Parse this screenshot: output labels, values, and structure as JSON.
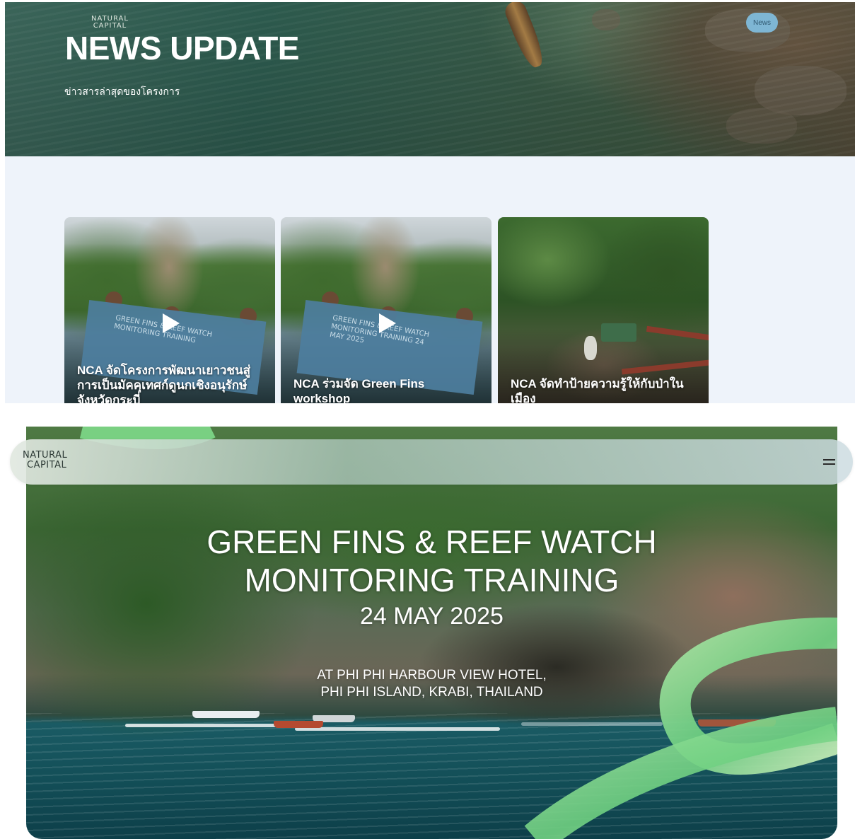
{
  "top_panel": {
    "logo": {
      "line1": "NATURAL",
      "line2": "CAPITAL"
    },
    "title": "NEWS UPDATE",
    "subtitle": "ข่าวสารล่าสุดของโครงการ",
    "badge": "News",
    "cards": [
      {
        "title": "NCA จัดโครงการพัฒนาเยาวชนสู่การเป็นมัคคุเทศก์ดูนกเชิงอนุรักษ์ จังหวัดกระบี่",
        "has_video": true,
        "banner_text": "GREEN FINS & REEF WATCH MONITORING TRAINING"
      },
      {
        "title": "NCA ร่วมจัด Green Fins workshop",
        "has_video": true,
        "banner_text": "GREEN FINS & REEF WATCH MONITORING TRAINING 24 MAY 2025"
      },
      {
        "title": "NCA จัดทำป้ายความรู้ให้กับป่าในเมือง",
        "has_video": false,
        "banner_text": ""
      }
    ]
  },
  "bottom_panel": {
    "logo": {
      "line1": "NATURAL",
      "line2": "CAPITAL"
    },
    "menu_icon": "hamburger-menu-icon",
    "video_title_line1": "GREEN FINS & REEF WATCH",
    "video_title_line2": "MONITORING TRAINING",
    "video_date": "24 MAY 2025",
    "video_location_line1": "AT PHI PHI HARBOUR VIEW HOTEL,",
    "video_location_line2": "PHI PHI ISLAND, KRABI, THAILAND"
  },
  "colors": {
    "accent_green": "#7ed98a",
    "badge_bg": "#7eb6d4",
    "page_bg": "#eef3fa"
  }
}
